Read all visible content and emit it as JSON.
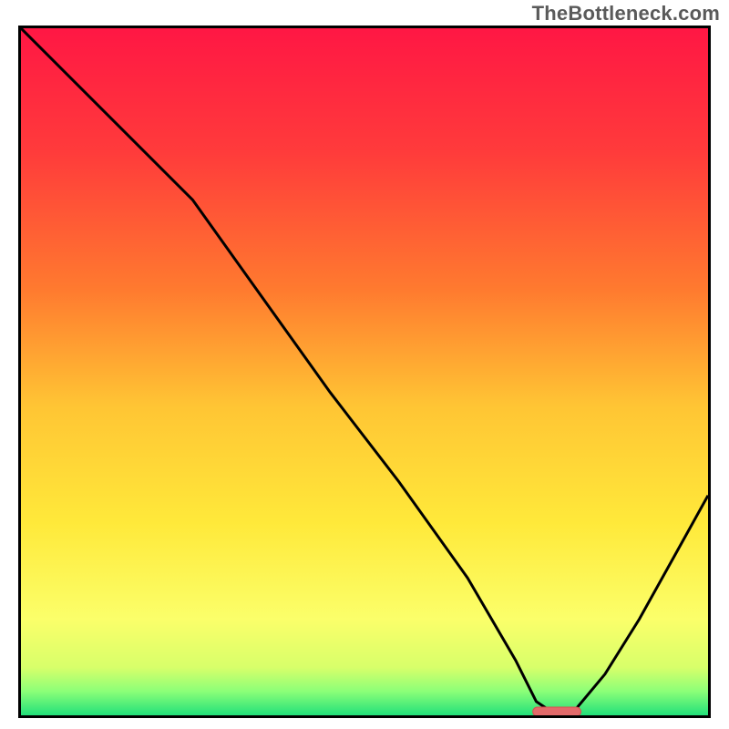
{
  "watermark": "TheBottleneck.com",
  "colors": {
    "border": "#000000",
    "curve": "#000000",
    "marker_fill": "#e26a6a",
    "marker_stroke": "#d94f4f",
    "gradient_stops": [
      {
        "offset": 0.0,
        "color": "#ff1744"
      },
      {
        "offset": 0.18,
        "color": "#ff3b3b"
      },
      {
        "offset": 0.38,
        "color": "#ff7a2f"
      },
      {
        "offset": 0.55,
        "color": "#ffc534"
      },
      {
        "offset": 0.72,
        "color": "#ffe93a"
      },
      {
        "offset": 0.86,
        "color": "#fbff6a"
      },
      {
        "offset": 0.93,
        "color": "#d8ff6a"
      },
      {
        "offset": 0.965,
        "color": "#8cff78"
      },
      {
        "offset": 1.0,
        "color": "#22e07a"
      }
    ]
  },
  "chart_data": {
    "type": "line",
    "title": "",
    "xlabel": "",
    "ylabel": "",
    "xlim": [
      0,
      100
    ],
    "ylim": [
      0,
      100
    ],
    "legend": false,
    "grid": false,
    "note": "Background is a vertical red→yellow→green gradient. Curve shows bottleneck mismatch (%) vs configuration position (%). Minimum ≈ 76–80% on x-axis.",
    "series": [
      {
        "name": "bottleneck-curve",
        "x": [
          0,
          8,
          18,
          25,
          35,
          45,
          55,
          65,
          72,
          75,
          78,
          80,
          85,
          90,
          95,
          100
        ],
        "values": [
          100,
          92,
          82,
          75,
          61,
          47,
          34,
          20,
          8,
          2,
          0,
          0,
          6,
          14,
          23,
          32
        ]
      }
    ],
    "marker": {
      "x_center": 78,
      "y": 0,
      "width": 7
    }
  }
}
